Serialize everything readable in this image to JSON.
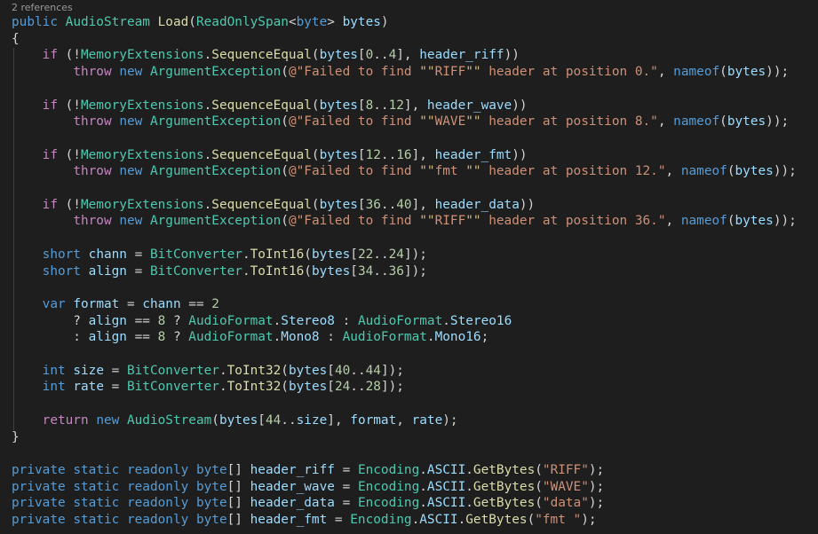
{
  "codelens": "2 references",
  "colors": {
    "background": "#1e1e1e",
    "keyword": "#569cd6",
    "control": "#c586c0",
    "type": "#4ec9b0",
    "method": "#dcdcaa",
    "variable": "#9cdcfe",
    "string": "#ce9178",
    "escape": "#d7ba7d",
    "number": "#b5cea8",
    "plain": "#d4d4d4"
  },
  "code_lines": [
    {
      "tokens": [
        [
          "kw",
          "public"
        ],
        [
          "p",
          " "
        ],
        [
          "ty",
          "AudioStream"
        ],
        [
          "p",
          " "
        ],
        [
          "fn",
          "Load"
        ],
        [
          "p",
          "("
        ],
        [
          "ty",
          "ReadOnlySpan"
        ],
        [
          "p",
          "<"
        ],
        [
          "kw",
          "byte"
        ],
        [
          "p",
          "> "
        ],
        [
          "var",
          "bytes"
        ],
        [
          "p",
          ")"
        ]
      ]
    },
    {
      "tokens": [
        [
          "p",
          "{"
        ]
      ]
    },
    {
      "tokens": [
        [
          "p",
          "    "
        ],
        [
          "ctl",
          "if"
        ],
        [
          "p",
          " (!"
        ],
        [
          "ty",
          "MemoryExtensions"
        ],
        [
          "p",
          "."
        ],
        [
          "fn",
          "SequenceEqual"
        ],
        [
          "p",
          "("
        ],
        [
          "var",
          "bytes"
        ],
        [
          "p",
          "["
        ],
        [
          "num",
          "0"
        ],
        [
          "p",
          ".."
        ],
        [
          "num",
          "4"
        ],
        [
          "p",
          "], "
        ],
        [
          "var",
          "header_riff"
        ],
        [
          "p",
          "))"
        ]
      ]
    },
    {
      "tokens": [
        [
          "p",
          "        "
        ],
        [
          "ctl",
          "throw"
        ],
        [
          "p",
          " "
        ],
        [
          "kw",
          "new"
        ],
        [
          "p",
          " "
        ],
        [
          "ty",
          "ArgumentException"
        ],
        [
          "p",
          "("
        ],
        [
          "str",
          "@\"Failed to find "
        ],
        [
          "esc",
          "\"\""
        ],
        [
          "str",
          "RIFF"
        ],
        [
          "esc",
          "\"\""
        ],
        [
          "str",
          " header at position 0.\""
        ],
        [
          "p",
          ", "
        ],
        [
          "kw",
          "nameof"
        ],
        [
          "p",
          "("
        ],
        [
          "var",
          "bytes"
        ],
        [
          "p",
          "));"
        ]
      ]
    },
    {
      "tokens": []
    },
    {
      "tokens": [
        [
          "p",
          "    "
        ],
        [
          "ctl",
          "if"
        ],
        [
          "p",
          " (!"
        ],
        [
          "ty",
          "MemoryExtensions"
        ],
        [
          "p",
          "."
        ],
        [
          "fn",
          "SequenceEqual"
        ],
        [
          "p",
          "("
        ],
        [
          "var",
          "bytes"
        ],
        [
          "p",
          "["
        ],
        [
          "num",
          "8"
        ],
        [
          "p",
          ".."
        ],
        [
          "num",
          "12"
        ],
        [
          "p",
          "], "
        ],
        [
          "var",
          "header_wave"
        ],
        [
          "p",
          "))"
        ]
      ]
    },
    {
      "tokens": [
        [
          "p",
          "        "
        ],
        [
          "ctl",
          "throw"
        ],
        [
          "p",
          " "
        ],
        [
          "kw",
          "new"
        ],
        [
          "p",
          " "
        ],
        [
          "ty",
          "ArgumentException"
        ],
        [
          "p",
          "("
        ],
        [
          "str",
          "@\"Failed to find "
        ],
        [
          "esc",
          "\"\""
        ],
        [
          "str",
          "WAVE"
        ],
        [
          "esc",
          "\"\""
        ],
        [
          "str",
          " header at position 8.\""
        ],
        [
          "p",
          ", "
        ],
        [
          "kw",
          "nameof"
        ],
        [
          "p",
          "("
        ],
        [
          "var",
          "bytes"
        ],
        [
          "p",
          "));"
        ]
      ]
    },
    {
      "tokens": []
    },
    {
      "tokens": [
        [
          "p",
          "    "
        ],
        [
          "ctl",
          "if"
        ],
        [
          "p",
          " (!"
        ],
        [
          "ty",
          "MemoryExtensions"
        ],
        [
          "p",
          "."
        ],
        [
          "fn",
          "SequenceEqual"
        ],
        [
          "p",
          "("
        ],
        [
          "var",
          "bytes"
        ],
        [
          "p",
          "["
        ],
        [
          "num",
          "12"
        ],
        [
          "p",
          ".."
        ],
        [
          "num",
          "16"
        ],
        [
          "p",
          "], "
        ],
        [
          "var",
          "header_fmt"
        ],
        [
          "p",
          "))"
        ]
      ]
    },
    {
      "tokens": [
        [
          "p",
          "        "
        ],
        [
          "ctl",
          "throw"
        ],
        [
          "p",
          " "
        ],
        [
          "kw",
          "new"
        ],
        [
          "p",
          " "
        ],
        [
          "ty",
          "ArgumentException"
        ],
        [
          "p",
          "("
        ],
        [
          "str",
          "@\"Failed to find "
        ],
        [
          "esc",
          "\"\""
        ],
        [
          "str",
          "fmt "
        ],
        [
          "esc",
          "\"\""
        ],
        [
          "str",
          " header at position 12.\""
        ],
        [
          "p",
          ", "
        ],
        [
          "kw",
          "nameof"
        ],
        [
          "p",
          "("
        ],
        [
          "var",
          "bytes"
        ],
        [
          "p",
          "));"
        ]
      ]
    },
    {
      "tokens": []
    },
    {
      "tokens": [
        [
          "p",
          "    "
        ],
        [
          "ctl",
          "if"
        ],
        [
          "p",
          " (!"
        ],
        [
          "ty",
          "MemoryExtensions"
        ],
        [
          "p",
          "."
        ],
        [
          "fn",
          "SequenceEqual"
        ],
        [
          "p",
          "("
        ],
        [
          "var",
          "bytes"
        ],
        [
          "p",
          "["
        ],
        [
          "num",
          "36"
        ],
        [
          "p",
          ".."
        ],
        [
          "num",
          "40"
        ],
        [
          "p",
          "], "
        ],
        [
          "var",
          "header_data"
        ],
        [
          "p",
          "))"
        ]
      ]
    },
    {
      "tokens": [
        [
          "p",
          "        "
        ],
        [
          "ctl",
          "throw"
        ],
        [
          "p",
          " "
        ],
        [
          "kw",
          "new"
        ],
        [
          "p",
          " "
        ],
        [
          "ty",
          "ArgumentException"
        ],
        [
          "p",
          "("
        ],
        [
          "str",
          "@\"Failed to find "
        ],
        [
          "esc",
          "\"\""
        ],
        [
          "str",
          "RIFF"
        ],
        [
          "esc",
          "\"\""
        ],
        [
          "str",
          " header at position 36.\""
        ],
        [
          "p",
          ", "
        ],
        [
          "kw",
          "nameof"
        ],
        [
          "p",
          "("
        ],
        [
          "var",
          "bytes"
        ],
        [
          "p",
          "));"
        ]
      ]
    },
    {
      "tokens": []
    },
    {
      "tokens": [
        [
          "p",
          "    "
        ],
        [
          "kw",
          "short"
        ],
        [
          "p",
          " "
        ],
        [
          "var",
          "chann"
        ],
        [
          "p",
          " = "
        ],
        [
          "ty",
          "BitConverter"
        ],
        [
          "p",
          "."
        ],
        [
          "fn",
          "ToInt16"
        ],
        [
          "p",
          "("
        ],
        [
          "var",
          "bytes"
        ],
        [
          "p",
          "["
        ],
        [
          "num",
          "22"
        ],
        [
          "p",
          ".."
        ],
        [
          "num",
          "24"
        ],
        [
          "p",
          "]);"
        ]
      ]
    },
    {
      "tokens": [
        [
          "p",
          "    "
        ],
        [
          "kw",
          "short"
        ],
        [
          "p",
          " "
        ],
        [
          "var",
          "align"
        ],
        [
          "p",
          " = "
        ],
        [
          "ty",
          "BitConverter"
        ],
        [
          "p",
          "."
        ],
        [
          "fn",
          "ToInt16"
        ],
        [
          "p",
          "("
        ],
        [
          "var",
          "bytes"
        ],
        [
          "p",
          "["
        ],
        [
          "num",
          "34"
        ],
        [
          "p",
          ".."
        ],
        [
          "num",
          "36"
        ],
        [
          "p",
          "]);"
        ]
      ]
    },
    {
      "tokens": []
    },
    {
      "tokens": [
        [
          "p",
          "    "
        ],
        [
          "kw",
          "var"
        ],
        [
          "p",
          " "
        ],
        [
          "var",
          "format"
        ],
        [
          "p",
          " = "
        ],
        [
          "var",
          "chann"
        ],
        [
          "p",
          " == "
        ],
        [
          "num",
          "2"
        ]
      ]
    },
    {
      "tokens": [
        [
          "p",
          "        ? "
        ],
        [
          "var",
          "align"
        ],
        [
          "p",
          " == "
        ],
        [
          "num",
          "8"
        ],
        [
          "p",
          " ? "
        ],
        [
          "ty",
          "AudioFormat"
        ],
        [
          "p",
          "."
        ],
        [
          "var",
          "Stereo8"
        ],
        [
          "p",
          " : "
        ],
        [
          "ty",
          "AudioFormat"
        ],
        [
          "p",
          "."
        ],
        [
          "var",
          "Stereo16"
        ]
      ]
    },
    {
      "tokens": [
        [
          "p",
          "        : "
        ],
        [
          "var",
          "align"
        ],
        [
          "p",
          " == "
        ],
        [
          "num",
          "8"
        ],
        [
          "p",
          " ? "
        ],
        [
          "ty",
          "AudioFormat"
        ],
        [
          "p",
          "."
        ],
        [
          "var",
          "Mono8"
        ],
        [
          "p",
          " : "
        ],
        [
          "ty",
          "AudioFormat"
        ],
        [
          "p",
          "."
        ],
        [
          "var",
          "Mono16"
        ],
        [
          "p",
          ";"
        ]
      ]
    },
    {
      "tokens": []
    },
    {
      "tokens": [
        [
          "p",
          "    "
        ],
        [
          "kw",
          "int"
        ],
        [
          "p",
          " "
        ],
        [
          "var",
          "size"
        ],
        [
          "p",
          " = "
        ],
        [
          "ty",
          "BitConverter"
        ],
        [
          "p",
          "."
        ],
        [
          "fn",
          "ToInt32"
        ],
        [
          "p",
          "("
        ],
        [
          "var",
          "bytes"
        ],
        [
          "p",
          "["
        ],
        [
          "num",
          "40"
        ],
        [
          "p",
          ".."
        ],
        [
          "num",
          "44"
        ],
        [
          "p",
          "]);"
        ]
      ]
    },
    {
      "tokens": [
        [
          "p",
          "    "
        ],
        [
          "kw",
          "int"
        ],
        [
          "p",
          " "
        ],
        [
          "var",
          "rate"
        ],
        [
          "p",
          " = "
        ],
        [
          "ty",
          "BitConverter"
        ],
        [
          "p",
          "."
        ],
        [
          "fn",
          "ToInt32"
        ],
        [
          "p",
          "("
        ],
        [
          "var",
          "bytes"
        ],
        [
          "p",
          "["
        ],
        [
          "num",
          "24"
        ],
        [
          "p",
          ".."
        ],
        [
          "num",
          "28"
        ],
        [
          "p",
          "]);"
        ]
      ]
    },
    {
      "tokens": []
    },
    {
      "tokens": [
        [
          "p",
          "    "
        ],
        [
          "ctl",
          "return"
        ],
        [
          "p",
          " "
        ],
        [
          "kw",
          "new"
        ],
        [
          "p",
          " "
        ],
        [
          "ty",
          "AudioStream"
        ],
        [
          "p",
          "("
        ],
        [
          "var",
          "bytes"
        ],
        [
          "p",
          "["
        ],
        [
          "num",
          "44"
        ],
        [
          "p",
          ".."
        ],
        [
          "var",
          "size"
        ],
        [
          "p",
          "], "
        ],
        [
          "var",
          "format"
        ],
        [
          "p",
          ", "
        ],
        [
          "var",
          "rate"
        ],
        [
          "p",
          ");"
        ]
      ]
    },
    {
      "tokens": [
        [
          "p",
          "}"
        ]
      ]
    },
    {
      "tokens": []
    },
    {
      "tokens": [
        [
          "kw",
          "private"
        ],
        [
          "p",
          " "
        ],
        [
          "kw",
          "static"
        ],
        [
          "p",
          " "
        ],
        [
          "kw",
          "readonly"
        ],
        [
          "p",
          " "
        ],
        [
          "kw",
          "byte"
        ],
        [
          "p",
          "[] "
        ],
        [
          "var",
          "header_riff"
        ],
        [
          "p",
          " = "
        ],
        [
          "ty",
          "Encoding"
        ],
        [
          "p",
          "."
        ],
        [
          "var",
          "ASCII"
        ],
        [
          "p",
          "."
        ],
        [
          "fn",
          "GetBytes"
        ],
        [
          "p",
          "("
        ],
        [
          "str",
          "\"RIFF\""
        ],
        [
          "p",
          ");"
        ]
      ]
    },
    {
      "tokens": [
        [
          "kw",
          "private"
        ],
        [
          "p",
          " "
        ],
        [
          "kw",
          "static"
        ],
        [
          "p",
          " "
        ],
        [
          "kw",
          "readonly"
        ],
        [
          "p",
          " "
        ],
        [
          "kw",
          "byte"
        ],
        [
          "p",
          "[] "
        ],
        [
          "var",
          "header_wave"
        ],
        [
          "p",
          " = "
        ],
        [
          "ty",
          "Encoding"
        ],
        [
          "p",
          "."
        ],
        [
          "var",
          "ASCII"
        ],
        [
          "p",
          "."
        ],
        [
          "fn",
          "GetBytes"
        ],
        [
          "p",
          "("
        ],
        [
          "str",
          "\"WAVE\""
        ],
        [
          "p",
          ");"
        ]
      ]
    },
    {
      "tokens": [
        [
          "kw",
          "private"
        ],
        [
          "p",
          " "
        ],
        [
          "kw",
          "static"
        ],
        [
          "p",
          " "
        ],
        [
          "kw",
          "readonly"
        ],
        [
          "p",
          " "
        ],
        [
          "kw",
          "byte"
        ],
        [
          "p",
          "[] "
        ],
        [
          "var",
          "header_data"
        ],
        [
          "p",
          " = "
        ],
        [
          "ty",
          "Encoding"
        ],
        [
          "p",
          "."
        ],
        [
          "var",
          "ASCII"
        ],
        [
          "p",
          "."
        ],
        [
          "fn",
          "GetBytes"
        ],
        [
          "p",
          "("
        ],
        [
          "str",
          "\"data\""
        ],
        [
          "p",
          ");"
        ]
      ]
    },
    {
      "tokens": [
        [
          "kw",
          "private"
        ],
        [
          "p",
          " "
        ],
        [
          "kw",
          "static"
        ],
        [
          "p",
          " "
        ],
        [
          "kw",
          "readonly"
        ],
        [
          "p",
          " "
        ],
        [
          "kw",
          "byte"
        ],
        [
          "p",
          "[] "
        ],
        [
          "var",
          "header_fmt"
        ],
        [
          "p",
          " = "
        ],
        [
          "ty",
          "Encoding"
        ],
        [
          "p",
          "."
        ],
        [
          "var",
          "ASCII"
        ],
        [
          "p",
          "."
        ],
        [
          "fn",
          "GetBytes"
        ],
        [
          "p",
          "("
        ],
        [
          "str",
          "\"fmt \""
        ],
        [
          "p",
          ");"
        ]
      ]
    }
  ]
}
